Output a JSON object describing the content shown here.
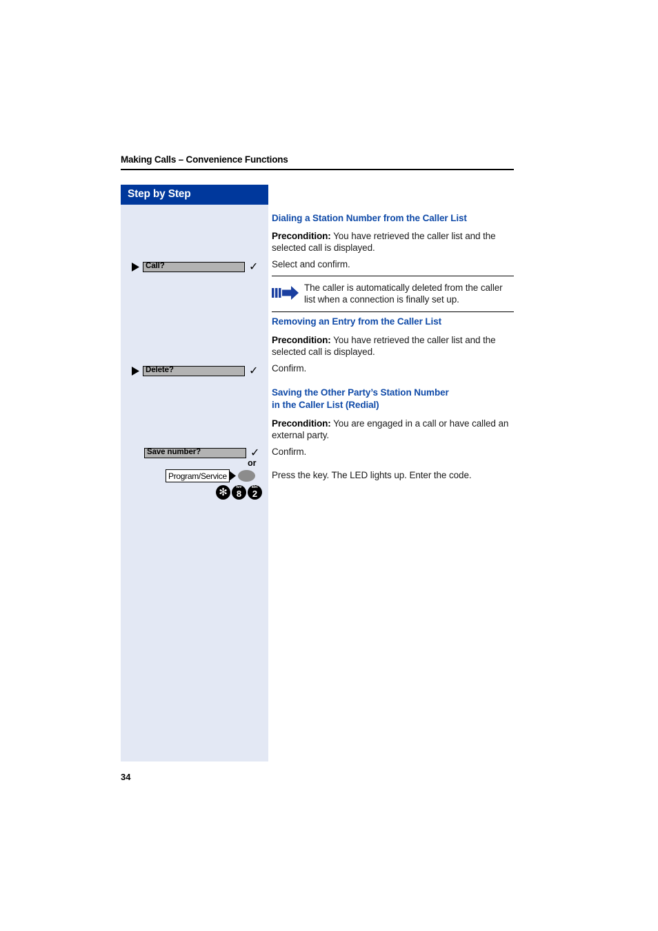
{
  "document": {
    "running_header": "Making Calls – Convenience Functions",
    "page_number": "34"
  },
  "sidebar": {
    "title": "Step by Step",
    "or_label": "or",
    "steps": [
      {
        "display_text": "Call?",
        "icon": "triangle-right-icon",
        "confirm": "✓"
      },
      {
        "display_text": "Delete?",
        "icon": "triangle-right-icon",
        "confirm": "✓"
      },
      {
        "display_text": "Save number?",
        "confirm": "✓"
      }
    ],
    "function_key": {
      "label": "Program/Service",
      "key_shape": "oval-key"
    },
    "keypad": [
      {
        "digit": "✻",
        "letters": ""
      },
      {
        "digit": "8",
        "letters": "tuv"
      },
      {
        "digit": "2",
        "letters": "abc"
      }
    ]
  },
  "content": {
    "section_1": {
      "heading": "Dialing a Station Number from the Caller List",
      "precondition_label": "Precondition:",
      "precondition_text": " You have retrieved the caller list and the selected call is displayed.",
      "action": "Select and confirm."
    },
    "note_1": {
      "icon": "note-arrow-icon",
      "text": "The caller is automatically deleted from the caller list when a connection is finally set up."
    },
    "section_2": {
      "heading": "Removing an Entry from the Caller List",
      "precondition_label": "Precondition:",
      "precondition_text": " You have retrieved the caller list and the selected call is displayed.",
      "action": "Confirm."
    },
    "section_3": {
      "heading_line_1": "Saving the Other Party’s Station Number",
      "heading_line_2": "in the Caller List (Redial)",
      "precondition_label": "Precondition:",
      "precondition_text": " You are engaged in a call or have called an external party.",
      "action": "Confirm.",
      "action_2": "Press the key. The LED lights up. Enter the code."
    }
  },
  "colors": {
    "heading_blue": "#0f4aa8",
    "sidebar_bar_blue": "#00389c",
    "sidebar_bg": "#e3e8f4",
    "display_gray": "#b3b3b3"
  }
}
